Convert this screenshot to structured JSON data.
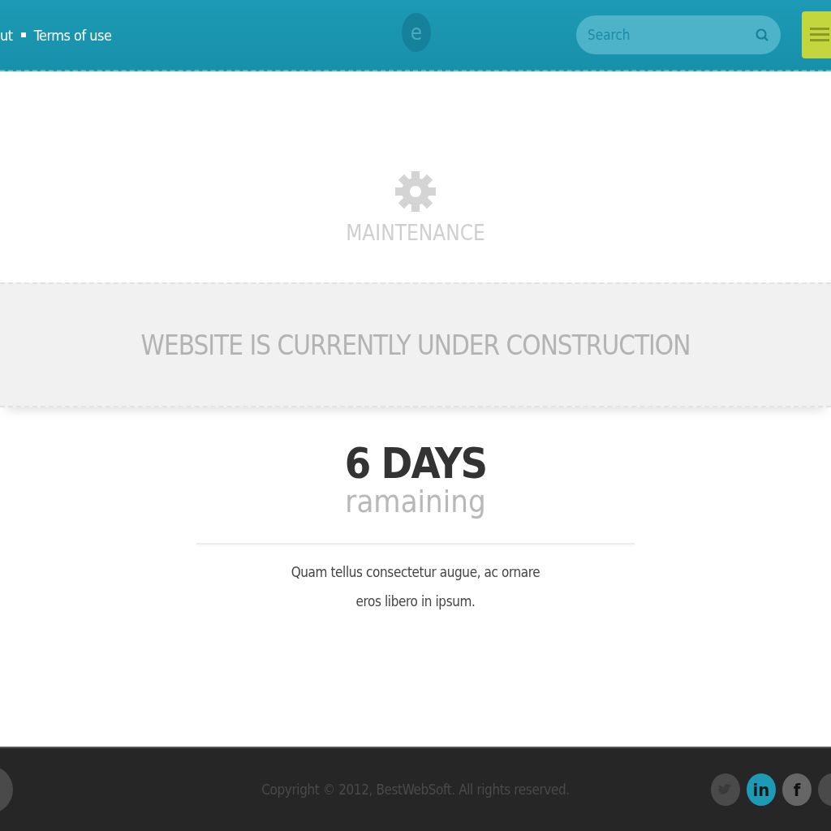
{
  "header": {
    "nav": [
      "ut",
      "Terms of use"
    ],
    "logo": "e",
    "search": {
      "placeholder": "Search"
    }
  },
  "status": {
    "title": "MAINTENANCE"
  },
  "banner": "WEBSITE IS CURRENTLY UNDER CONSTRUCTION",
  "countdown": {
    "value": "6 DAYS",
    "label": "ramaining"
  },
  "message": "Quam tellus consectetur augue, ac ornare eros libero in ipsum.",
  "footer": {
    "copyright": "Copyright © 2012, BestWebSoft. All rights reserved.",
    "social": [
      {
        "kind": "bird",
        "selected": false
      },
      {
        "kind": "text",
        "label": "in",
        "selected": true
      },
      {
        "kind": "text",
        "label": "f",
        "selected": false
      },
      {
        "kind": "cut",
        "selected": false
      }
    ]
  }
}
